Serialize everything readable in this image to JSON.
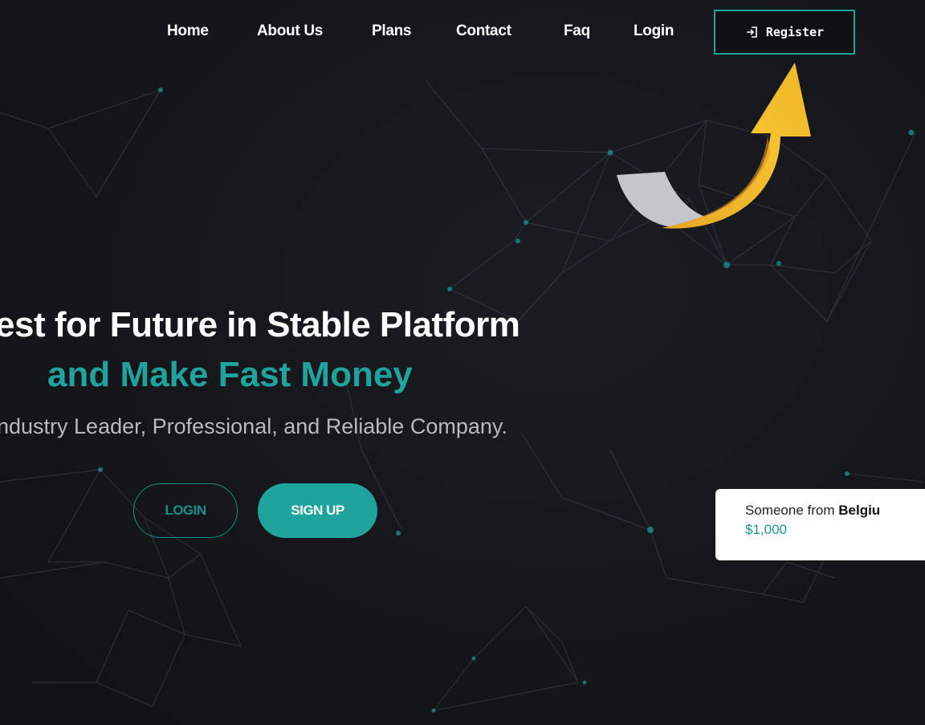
{
  "nav": {
    "links": [
      "Home",
      "About Us",
      "Plans",
      "Contact",
      "Faq",
      "Login"
    ],
    "register_label": "Register"
  },
  "hero": {
    "title": "est for Future in Stable Platform",
    "subtitle": "and Make Fast Money",
    "description": "ndustry Leader, Professional, and Reliable Company.",
    "login_button": "LOGIN",
    "signup_button": "SIGN UP"
  },
  "toast": {
    "prefix": "Someone from ",
    "country": "Belgiu",
    "amount": "$1,000"
  },
  "colors": {
    "background": "#15161b",
    "accent": "#1fa39c",
    "arrow": "#f2b52a"
  }
}
